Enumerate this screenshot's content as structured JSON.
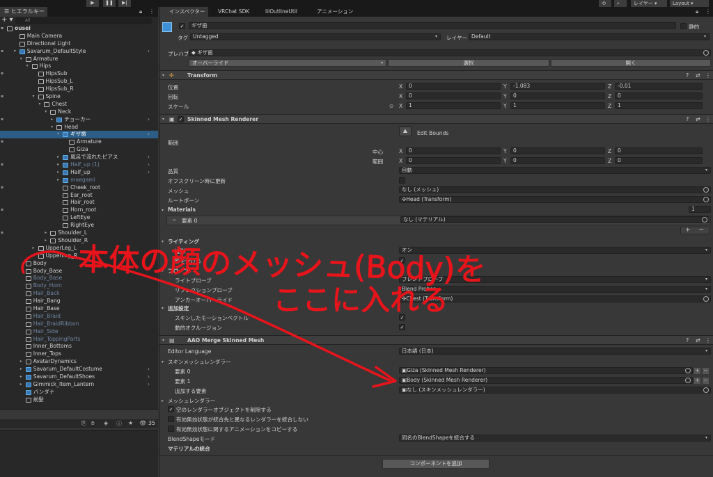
{
  "toolbar": {
    "play": "▶",
    "pause": "❚❚",
    "step": "▶|",
    "layer": "レイヤー",
    "layout": "Layout"
  },
  "hierarchy": {
    "tab": "ヒエラルキー",
    "search_placeholder": "All",
    "add": "+ ▾",
    "rows": [
      {
        "label": "ousei",
        "indent": 0,
        "arrow": "▾",
        "icon": "scene",
        "bold": true,
        "state": "normal"
      },
      {
        "label": "Main Camera",
        "indent": 2,
        "arrow": "",
        "icon": "go",
        "state": "normal"
      },
      {
        "label": "Directional Light",
        "indent": 2,
        "arrow": "",
        "icon": "go",
        "state": "normal"
      },
      {
        "label": "Savarum_DefaultStyle",
        "indent": 2,
        "arrow": "▾",
        "icon": "prefab",
        "state": "normal",
        "chev": true
      },
      {
        "label": "Armature",
        "indent": 3,
        "arrow": "▾",
        "icon": "go",
        "state": "normal"
      },
      {
        "label": "Hips",
        "indent": 4,
        "arrow": "▾",
        "icon": "go",
        "state": "normal"
      },
      {
        "label": "HipsSub",
        "indent": 5,
        "arrow": "",
        "icon": "go",
        "state": "normal"
      },
      {
        "label": "HipsSub_L",
        "indent": 5,
        "arrow": "",
        "icon": "go",
        "state": "normal"
      },
      {
        "label": "HipsSub_R",
        "indent": 5,
        "arrow": "",
        "icon": "go",
        "state": "normal"
      },
      {
        "label": "Spine",
        "indent": 5,
        "arrow": "▾",
        "icon": "go",
        "state": "normal"
      },
      {
        "label": "Chest",
        "indent": 6,
        "arrow": "▾",
        "icon": "go",
        "state": "normal"
      },
      {
        "label": "Neck",
        "indent": 7,
        "arrow": "▾",
        "icon": "go",
        "state": "normal"
      },
      {
        "label": "チョーカー",
        "indent": 8,
        "arrow": "▸",
        "icon": "prefab",
        "state": "normal",
        "chev": true
      },
      {
        "label": "Head",
        "indent": 8,
        "arrow": "▾",
        "icon": "go",
        "state": "normal"
      },
      {
        "label": "ギザ歯",
        "indent": 9,
        "arrow": "▾",
        "icon": "prefab",
        "state": "selected",
        "chev": true
      },
      {
        "label": "Armature",
        "indent": 10,
        "arrow": "",
        "icon": "go",
        "state": "normal"
      },
      {
        "label": "Giza",
        "indent": 10,
        "arrow": "",
        "icon": "go",
        "state": "normal"
      },
      {
        "label": "風呂で流れたピアス",
        "indent": 9,
        "arrow": "▸",
        "icon": "prefab",
        "state": "normal",
        "chev": true
      },
      {
        "label": "Half_up (1)",
        "indent": 9,
        "arrow": "▸",
        "icon": "prefab",
        "state": "dim",
        "chev": true
      },
      {
        "label": "Half_up",
        "indent": 9,
        "arrow": "▸",
        "icon": "prefab",
        "state": "normal",
        "chev": true
      },
      {
        "label": "maegami",
        "indent": 9,
        "arrow": "▸",
        "icon": "prefab",
        "state": "dim"
      },
      {
        "label": "Cheek_root",
        "indent": 9,
        "arrow": "",
        "icon": "go",
        "state": "normal"
      },
      {
        "label": "Ear_root",
        "indent": 9,
        "arrow": "",
        "icon": "go",
        "state": "normal"
      },
      {
        "label": "Hair_root",
        "indent": 9,
        "arrow": "",
        "icon": "go",
        "state": "normal"
      },
      {
        "label": "Horn_root",
        "indent": 9,
        "arrow": "",
        "icon": "go",
        "state": "normal"
      },
      {
        "label": "LeftEye",
        "indent": 9,
        "arrow": "",
        "icon": "go",
        "state": "normal"
      },
      {
        "label": "RightEye",
        "indent": 9,
        "arrow": "",
        "icon": "go",
        "state": "normal"
      },
      {
        "label": "Shoulder_L",
        "indent": 7,
        "arrow": "▸",
        "icon": "go",
        "state": "normal"
      },
      {
        "label": "Shoulder_R",
        "indent": 7,
        "arrow": "▸",
        "icon": "go",
        "state": "normal"
      },
      {
        "label": "UpperLeg_L",
        "indent": 5,
        "arrow": "▸",
        "icon": "go",
        "state": "normal"
      },
      {
        "label": "UpperLeg_R",
        "indent": 5,
        "arrow": "▸",
        "icon": "go",
        "state": "normal"
      },
      {
        "label": "Body",
        "indent": 3,
        "arrow": "",
        "icon": "go",
        "state": "normal"
      },
      {
        "label": "Body_Base",
        "indent": 3,
        "arrow": "",
        "icon": "go",
        "state": "normal"
      },
      {
        "label": "Body_Base",
        "indent": 3,
        "arrow": "",
        "icon": "go",
        "state": "dim"
      },
      {
        "label": "Body_Horn",
        "indent": 3,
        "arrow": "",
        "icon": "go",
        "state": "dim"
      },
      {
        "label": "Hair_Back",
        "indent": 3,
        "arrow": "",
        "icon": "go",
        "state": "dim"
      },
      {
        "label": "Hair_Bang",
        "indent": 3,
        "arrow": "",
        "icon": "go",
        "state": "normal"
      },
      {
        "label": "Hair_Base",
        "indent": 3,
        "arrow": "",
        "icon": "go",
        "state": "normal"
      },
      {
        "label": "Hair_Braid",
        "indent": 3,
        "arrow": "",
        "icon": "go",
        "state": "dim"
      },
      {
        "label": "Hair_BraidRibbon",
        "indent": 3,
        "arrow": "",
        "icon": "go",
        "state": "dim"
      },
      {
        "label": "Hair_Side",
        "indent": 3,
        "arrow": "",
        "icon": "go",
        "state": "dim"
      },
      {
        "label": "Hair_ToppingParts",
        "indent": 3,
        "arrow": "",
        "icon": "go",
        "state": "dim"
      },
      {
        "label": "Inner_Bottoms",
        "indent": 3,
        "arrow": "",
        "icon": "go",
        "state": "normal"
      },
      {
        "label": "Inner_Tops",
        "indent": 3,
        "arrow": "",
        "icon": "go",
        "state": "normal"
      },
      {
        "label": "AvatarDynamics",
        "indent": 3,
        "arrow": "▸",
        "icon": "go",
        "state": "normal"
      },
      {
        "label": "Savarum_DefaultCostume",
        "indent": 3,
        "arrow": "▸",
        "icon": "prefab",
        "state": "normal",
        "chev": true
      },
      {
        "label": "Savarum_DefaultShoes",
        "indent": 3,
        "arrow": "▸",
        "icon": "prefab",
        "state": "normal",
        "chev": true
      },
      {
        "label": "Gimmick_Item_Lantern",
        "indent": 3,
        "arrow": "▸",
        "icon": "prefab",
        "state": "normal",
        "chev": true
      },
      {
        "label": "バンダナ",
        "indent": 3,
        "arrow": "",
        "icon": "prefab",
        "state": "normal"
      },
      {
        "label": "前髪",
        "indent": 3,
        "arrow": "",
        "icon": "go",
        "state": "normal"
      }
    ],
    "status_count": "35"
  },
  "inspector": {
    "tabs": [
      "インスペクター",
      "VRChat SDK",
      "lilOutlineUtil",
      "アニメーション"
    ],
    "object_name": "ギザ歯",
    "static_label": "静的",
    "tag_label": "タグ",
    "tag_value": "Untagged",
    "layer_label": "レイヤー",
    "layer_value": "Default",
    "prefab_label": "プレハブ",
    "prefab_value": "ギザ歯",
    "overrides": "オーバーライド",
    "select": "選択",
    "open": "開く",
    "transform": {
      "title": "Transform",
      "position": "位置",
      "rotation": "回転",
      "scale": "スケール",
      "pos": [
        "0",
        "-1.083",
        "-0.01"
      ],
      "rot": [
        "0",
        "0",
        "0"
      ],
      "scl": [
        "1",
        "1",
        "1"
      ]
    },
    "smr": {
      "title": "Skinned Mesh Renderer",
      "edit_bounds": "Edit Bounds",
      "bounds": "範囲",
      "center": "中心",
      "extent": "範囲",
      "center_v": [
        "0",
        "0",
        "0"
      ],
      "extent_v": [
        "0",
        "0",
        "0"
      ],
      "quality_label": "品質",
      "quality": "自動",
      "offscreen": "オフスクリーン時に更新",
      "mesh_label": "メッシュ",
      "mesh": "なし (メッシュ)",
      "root_bone_label": "ルートボーン",
      "root_bone": "Head (Transform)",
      "materials": "Materials",
      "materials_count": "1",
      "element0": "要素 0",
      "element0_value": "なし (マテリアル)",
      "lighting": "ライティング",
      "cast_shadows": "投影",
      "cast_shadows_value": "オン",
      "receive_shadows": "影を受ける",
      "probes": "プローブ",
      "light_probes": "ライトプローブ",
      "light_probes_value": "ブレンドプローブ",
      "reflection_probes": "リフレクションプローブ",
      "reflection_probes_value": "Blend Probes",
      "anchor_override": "アンカーオーバーライド",
      "anchor_value": "Chest (Transform)",
      "additional": "追加設定",
      "motion_vectors": "スキンしたモーションベクトル",
      "dynamic_occlusion": "動的オクルージョン"
    },
    "aao": {
      "title": "AAO Merge Skinned Mesh",
      "editor_language": "Editor Language",
      "language": "日本語 (日本)",
      "renderers": "スキンメッシュレンダラー",
      "el0": "要素 0",
      "el0_value": "Giza (Skinned Mesh Renderer)",
      "el1": "要素 1",
      "el1_value": "Body (Skinned Mesh Renderer)",
      "add_el": "追加する要素",
      "add_el_value": "なし (スキンメッシュレンダラー)",
      "mesh_renderers": "メッシュレンダラー",
      "opt1": "空のレンダラーオブジェクトを削除する",
      "opt2": "有効無効状態が統合先と異なるレンダラーを統合しない",
      "opt3": "有効無効状態に関するアニメーションをコピーする",
      "blendshape_label": "BlendShapeモード",
      "blendshape_value": "同名のBlendShapeを統合する",
      "material_merge": "マテリアルの統合"
    },
    "add_component": "コンポーネントを追加"
  },
  "annotation": {
    "line1": "本体の顔のメッシュ(Body)を",
    "line2": "ここに入れる",
    "color": "#e8141b"
  }
}
